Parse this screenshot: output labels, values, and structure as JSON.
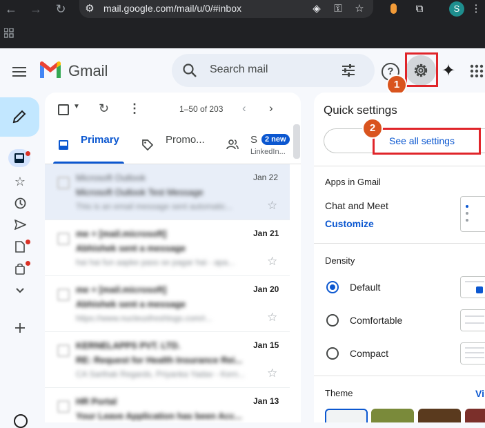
{
  "browser": {
    "url": "mail.google.com/mail/u/0/#inbox",
    "profile_initial": "S"
  },
  "header": {
    "logo_text": "Gmail",
    "search_placeholder": "Search mail"
  },
  "callouts": {
    "one": "1",
    "two": "2"
  },
  "toolbar": {
    "range": "1–50 of 203"
  },
  "tabs": {
    "primary": "Primary",
    "promotions": "Promo...",
    "social_initial": "S",
    "social_badge": "2 new",
    "social_sub": "LinkedIn..."
  },
  "emails": [
    {
      "sender": "Microsoft Outlook",
      "subject": "Microsoft Outlook Test Message",
      "snippet": "This is an email message sent automatic...",
      "date": "Jan 22",
      "unread": false
    },
    {
      "sender": "me + [mail.microsoft]",
      "subject": "Abhishek sent a message",
      "snippet": "hai hai fun aapke pass se pagar hai - apa...",
      "date": "Jan 21",
      "unread": true
    },
    {
      "sender": "me + [mail.microsoft]",
      "subject": "Abhishek sent a message",
      "snippet": "https://www.nucleusfreshlogs.com/r...",
      "date": "Jan 20",
      "unread": true
    },
    {
      "sender": "KERNELAPPS PVT. LTD.",
      "subject": "RE: Request for Health Insurance Rei...",
      "snippet": "CA Sarthak Regards, Priyanka Yadav - Kern...",
      "date": "Jan 15",
      "unread": true
    },
    {
      "sender": "HR Portal",
      "subject": "Your Leave Application has been Acc...",
      "snippet": "",
      "date": "Jan 13",
      "unread": true
    }
  ],
  "quick_settings": {
    "title": "Quick settings",
    "see_all": "See all settings",
    "apps_heading": "Apps in Gmail",
    "chat_meet": "Chat and Meet",
    "customize": "Customize",
    "density_heading": "Density",
    "density_options": [
      "Default",
      "Comfortable",
      "Compact"
    ],
    "density_selected": "Default",
    "theme_heading": "Theme",
    "theme_view_all": "Vi"
  },
  "colors": {
    "accent": "#0b57d0",
    "callout_red": "#e0252a",
    "callout_badge": "#d9541e"
  }
}
